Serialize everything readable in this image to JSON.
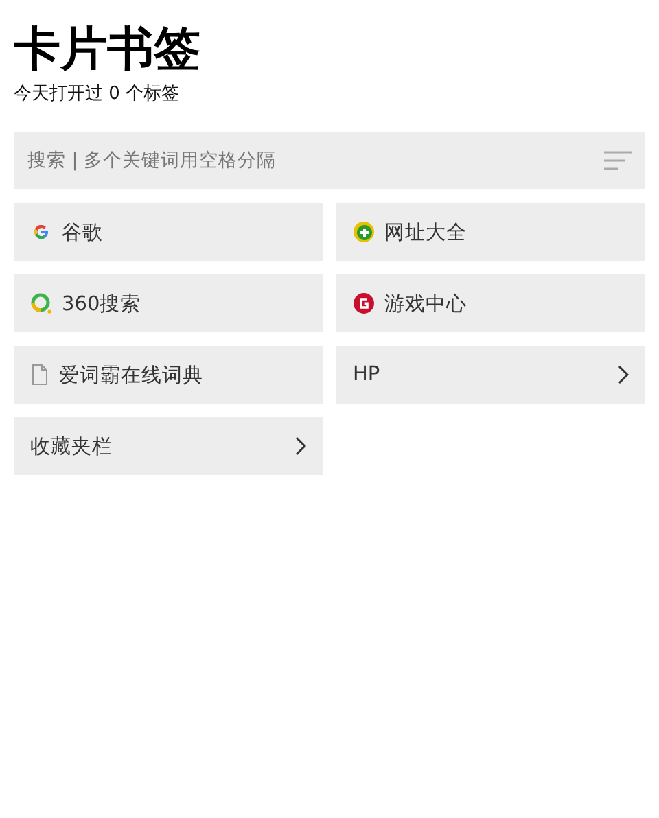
{
  "title": "卡片书签",
  "subtitle": "今天打开过 0 个标签",
  "search": {
    "placeholder": "搜索 | 多个关键词用空格分隔"
  },
  "items": [
    {
      "kind": "bookmark",
      "label": "谷歌"
    },
    {
      "kind": "bookmark",
      "label": "网址大全"
    },
    {
      "kind": "bookmark",
      "label": "360搜索"
    },
    {
      "kind": "bookmark",
      "label": "游戏中心"
    },
    {
      "kind": "bookmark",
      "label": "爱词霸在线词典"
    },
    {
      "kind": "folder",
      "label": "HP"
    },
    {
      "kind": "folder",
      "label": "收藏夹栏"
    }
  ]
}
